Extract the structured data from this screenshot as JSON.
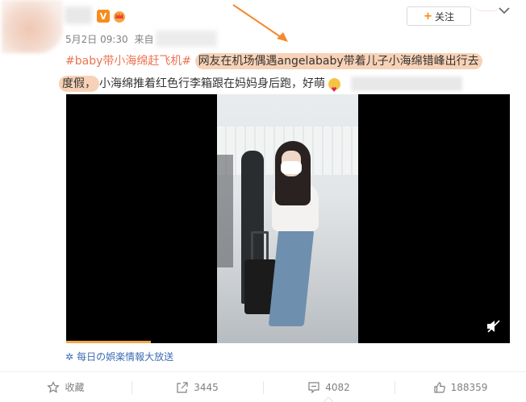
{
  "post": {
    "badge_v": "V",
    "date": "5月2日 09:30",
    "source_prefix": "来自",
    "follow_label": "关注",
    "follow_plus": "+",
    "topic": "#baby带小海绵赶飞机#",
    "highlight_line1": "网友在机场偶遇angelababy带着儿子小海绵错峰出行去",
    "highlight_line2": "度假，",
    "text_rest": "小海绵推着红色行李箱跟在妈妈身后跑，好萌"
  },
  "video": {
    "progress": 0.19,
    "channel": "每日の娯楽情報大放送"
  },
  "actions": [
    {
      "label": "收藏",
      "icon": "star-icon"
    },
    {
      "label": "3445",
      "icon": "share-icon"
    },
    {
      "label": "4082",
      "icon": "comment-icon"
    },
    {
      "label": "188359",
      "icon": "like-icon"
    }
  ],
  "colors": {
    "topic": "#eb7350",
    "highlight": "#f8d2b6",
    "channel": "#3d6bb5",
    "accent": "#ff8200"
  }
}
